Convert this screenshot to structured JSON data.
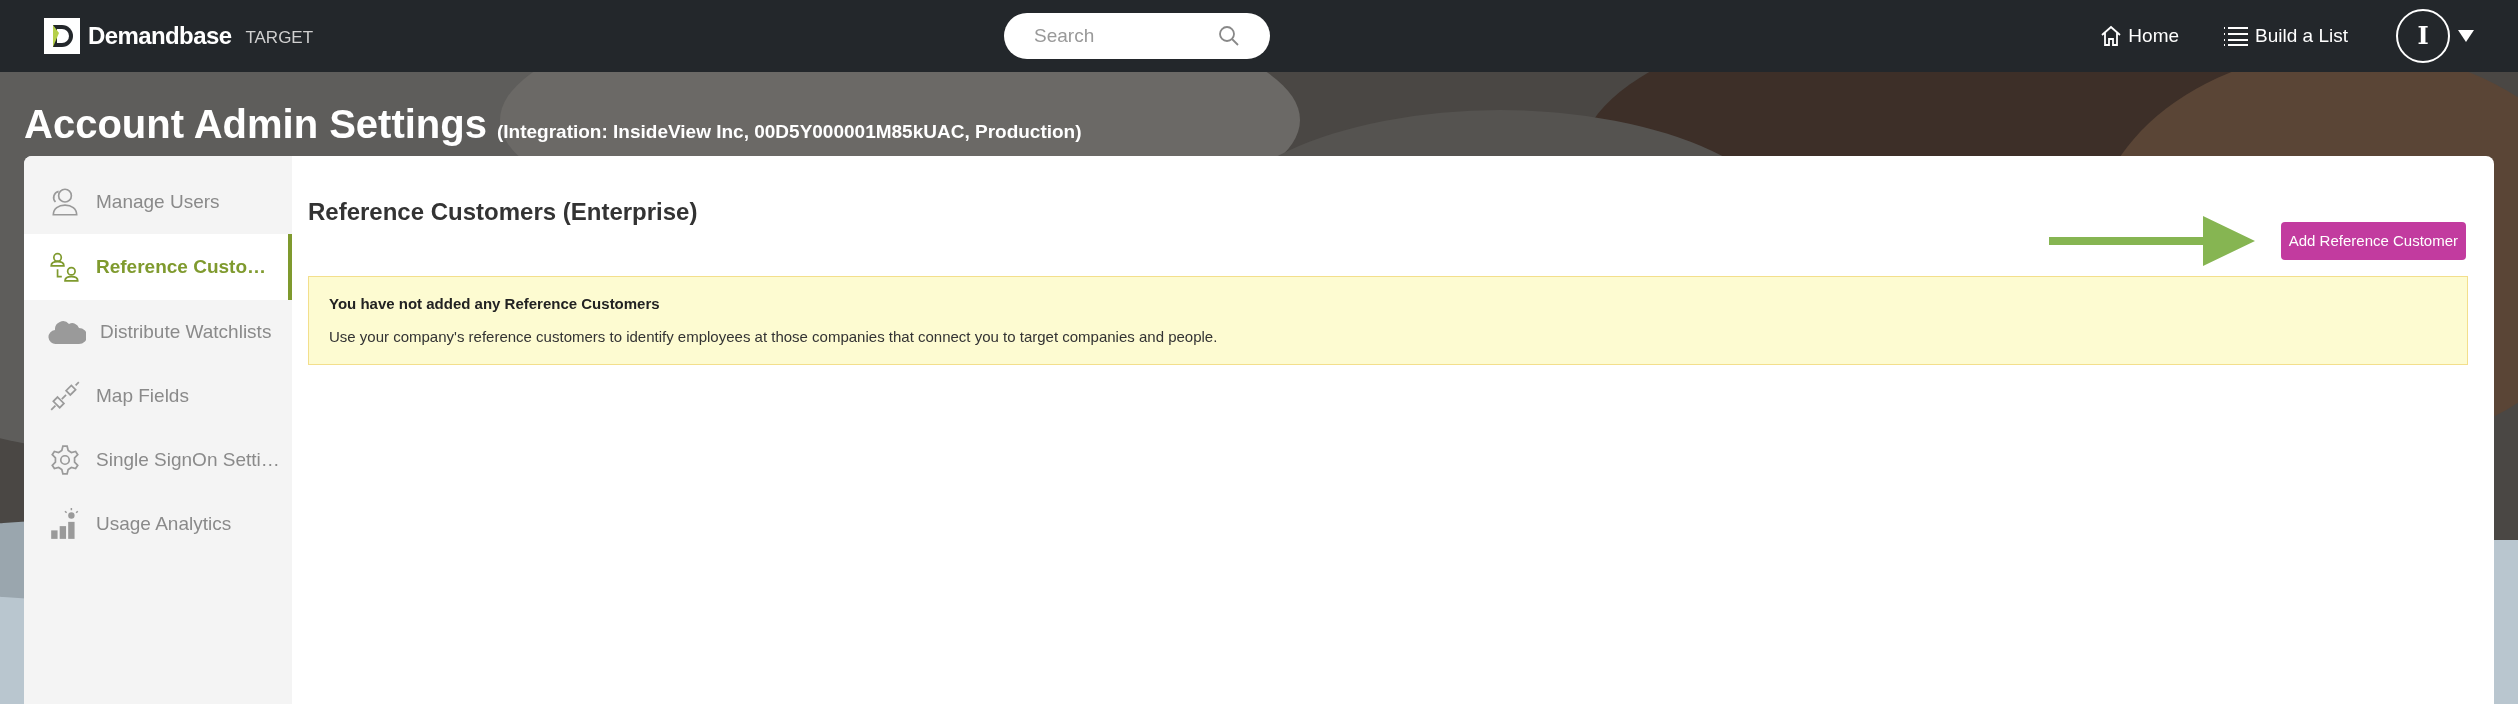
{
  "header": {
    "logo": "Demandbase",
    "product": "TARGET",
    "search": {
      "placeholder": "Search"
    },
    "nav": [
      {
        "label": "Home"
      },
      {
        "label": "Build a List"
      }
    ],
    "avatar": "I"
  },
  "page": {
    "title": "Account Admin Settings",
    "subtitle": "(Integration: InsideView Inc, 00D5Y000001M85kUAC, Production)"
  },
  "sidebar": {
    "items": [
      {
        "label": "Manage Users",
        "selected": false
      },
      {
        "label": "Reference Custo…",
        "selected": true
      },
      {
        "label": "Distribute Watchlists",
        "selected": false
      },
      {
        "label": "Map Fields",
        "selected": false
      },
      {
        "label": "Single SignOn Setti…",
        "selected": false
      },
      {
        "label": "Usage Analytics",
        "selected": false
      }
    ]
  },
  "content": {
    "heading": "Reference Customers (Enterprise)",
    "action": "Add Reference Customer",
    "notice": {
      "title": "You have not added any Reference Customers",
      "body": "Use your company's reference customers to identify employees at those companies that connect you to target companies and people."
    }
  }
}
